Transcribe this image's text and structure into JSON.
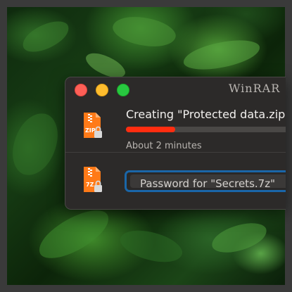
{
  "app": {
    "title": "WinRAR"
  },
  "window_controls": [
    "close",
    "minimize",
    "zoom"
  ],
  "tasks": [
    {
      "type": "compress",
      "icon": "zip-archive-locked-icon",
      "icon_label": "ZIP",
      "title": "Creating \"Protected data.zip",
      "progress": 0.31,
      "eta": "About 2 minutes"
    },
    {
      "type": "password",
      "icon": "7z-archive-locked-icon",
      "icon_label": "7Z",
      "password_placeholder": "Password for \"Secrets.7z\""
    }
  ],
  "colors": {
    "progress_fill": "#ff2d10",
    "focus_ring": "#1a66a8",
    "archive_icon": "#ff7a18",
    "lock_badge": "#d9d9d9"
  }
}
